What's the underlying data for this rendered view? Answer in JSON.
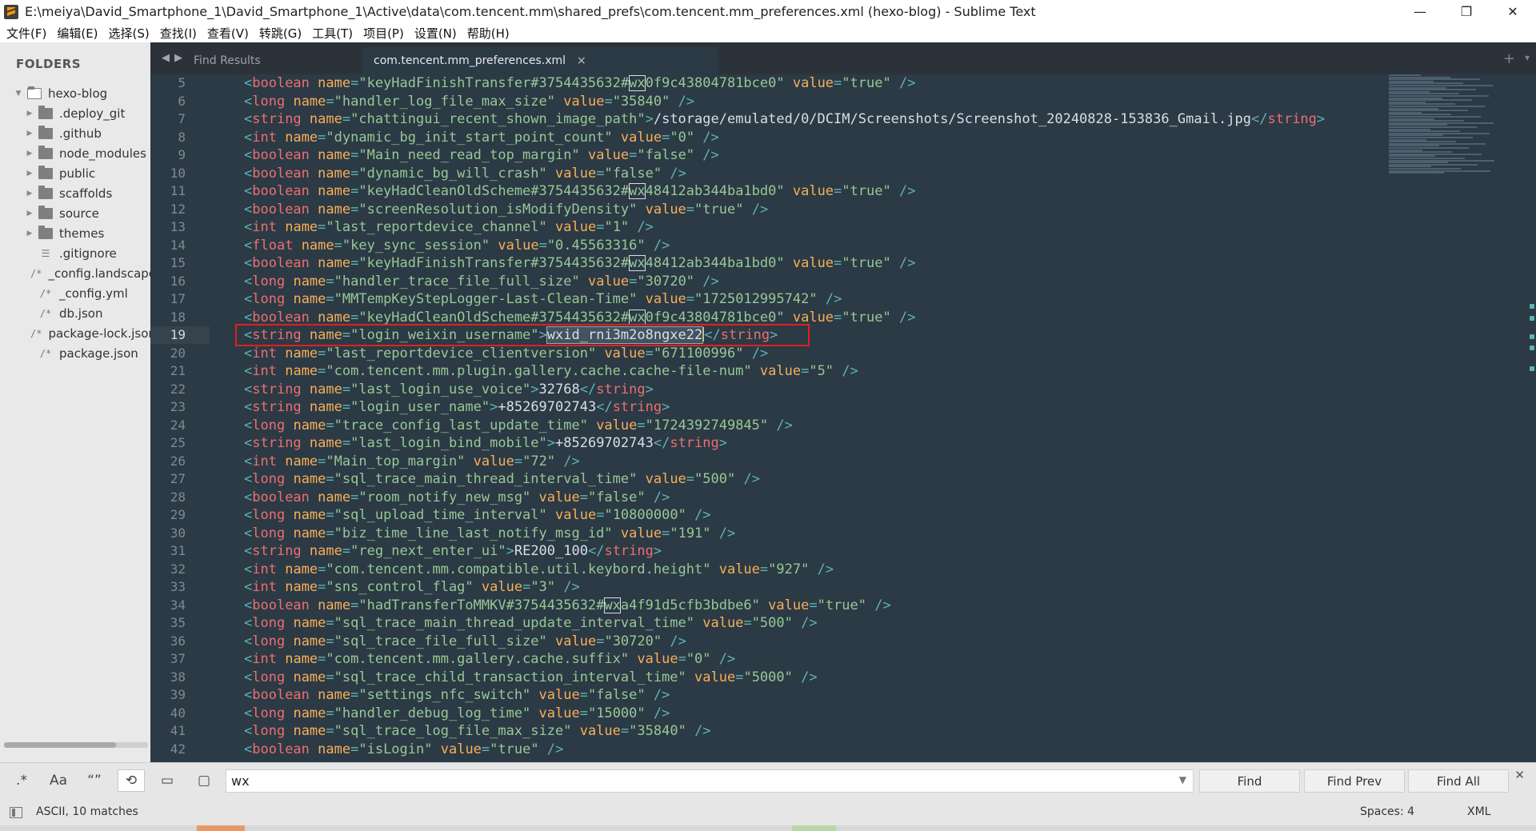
{
  "window": {
    "title": "E:\\meiya\\David_Smartphone_1\\David_Smartphone_1\\Active\\data\\com.tencent.mm\\shared_prefs\\com.tencent.mm_preferences.xml (hexo-blog) - Sublime Text",
    "minimize": "—",
    "maximize": "❐",
    "close": "✕"
  },
  "menu": [
    "文件(F)",
    "编辑(E)",
    "选择(S)",
    "查找(I)",
    "查看(V)",
    "转跳(G)",
    "工具(T)",
    "项目(P)",
    "设置(N)",
    "帮助(H)"
  ],
  "sidebar": {
    "header": "FOLDERS",
    "root": "hexo-blog",
    "items": [
      {
        "label": ".deploy_git",
        "type": "folder"
      },
      {
        "label": ".github",
        "type": "folder"
      },
      {
        "label": "node_modules",
        "type": "folder"
      },
      {
        "label": "public",
        "type": "folder"
      },
      {
        "label": "scaffolds",
        "type": "folder"
      },
      {
        "label": "source",
        "type": "folder"
      },
      {
        "label": "themes",
        "type": "folder"
      },
      {
        "label": ".gitignore",
        "type": "file"
      },
      {
        "label": "_config.landscape",
        "type": "file"
      },
      {
        "label": "_config.yml",
        "type": "file"
      },
      {
        "label": "db.json",
        "type": "file"
      },
      {
        "label": "package-lock.json",
        "type": "file"
      },
      {
        "label": "package.json",
        "type": "file"
      }
    ]
  },
  "tabs": {
    "inactive": "Find Results",
    "active": "com.tencent.mm_preferences.xml",
    "close": "×",
    "plus": "+",
    "dropdown": "▾"
  },
  "editor": {
    "current_line": 19,
    "match_highlight": "wx",
    "lines": [
      {
        "n": 5,
        "tag": "boolean",
        "name": "keyHadFinishTransfer#3754435632#wx0f9c43804781bce0",
        "value": "true"
      },
      {
        "n": 6,
        "tag": "long",
        "name": "handler_log_file_max_size",
        "value": "35840"
      },
      {
        "n": 7,
        "tag": "string",
        "name": "chattingui_recent_shown_image_path",
        "text": "/storage/emulated/0/DCIM/Screenshots/Screenshot_20240828-153836_Gmail.jpg"
      },
      {
        "n": 8,
        "tag": "int",
        "name": "dynamic_bg_init_start_point_count",
        "value": "0"
      },
      {
        "n": 9,
        "tag": "boolean",
        "name": "Main_need_read_top_margin",
        "value": "false"
      },
      {
        "n": 10,
        "tag": "boolean",
        "name": "dynamic_bg_will_crash",
        "value": "false"
      },
      {
        "n": 11,
        "tag": "boolean",
        "name": "keyHadCleanOldScheme#3754435632#wx48412ab344ba1bd0",
        "value": "true"
      },
      {
        "n": 12,
        "tag": "boolean",
        "name": "screenResolution_isModifyDensity",
        "value": "true"
      },
      {
        "n": 13,
        "tag": "int",
        "name": "last_reportdevice_channel",
        "value": "1"
      },
      {
        "n": 14,
        "tag": "float",
        "name": "key_sync_session",
        "value": "0.45563316"
      },
      {
        "n": 15,
        "tag": "boolean",
        "name": "keyHadFinishTransfer#3754435632#wx48412ab344ba1bd0",
        "value": "true"
      },
      {
        "n": 16,
        "tag": "long",
        "name": "handler_trace_file_full_size",
        "value": "30720"
      },
      {
        "n": 17,
        "tag": "long",
        "name": "MMTempKeyStepLogger-Last-Clean-Time",
        "value": "1725012995742"
      },
      {
        "n": 18,
        "tag": "boolean",
        "name": "keyHadCleanOldScheme#3754435632#wx0f9c43804781bce0",
        "value": "true"
      },
      {
        "n": 19,
        "tag": "string",
        "name": "login_weixin_username",
        "text": "wxid_rni3m2o8ngxe22"
      },
      {
        "n": 20,
        "tag": "int",
        "name": "last_reportdevice_clientversion",
        "value": "671100996"
      },
      {
        "n": 21,
        "tag": "int",
        "name": "com.tencent.mm.plugin.gallery.cache.cache-file-num",
        "value": "5"
      },
      {
        "n": 22,
        "tag": "string",
        "name": "last_login_use_voice",
        "text": "32768"
      },
      {
        "n": 23,
        "tag": "string",
        "name": "login_user_name",
        "text": "+85269702743"
      },
      {
        "n": 24,
        "tag": "long",
        "name": "trace_config_last_update_time",
        "value": "1724392749845"
      },
      {
        "n": 25,
        "tag": "string",
        "name": "last_login_bind_mobile",
        "text": "+85269702743"
      },
      {
        "n": 26,
        "tag": "int",
        "name": "Main_top_margin",
        "value": "72"
      },
      {
        "n": 27,
        "tag": "long",
        "name": "sql_trace_main_thread_interval_time",
        "value": "500"
      },
      {
        "n": 28,
        "tag": "boolean",
        "name": "room_notify_new_msg",
        "value": "false"
      },
      {
        "n": 29,
        "tag": "long",
        "name": "sql_upload_time_interval",
        "value": "10800000"
      },
      {
        "n": 30,
        "tag": "long",
        "name": "biz_time_line_last_notify_msg_id",
        "value": "191"
      },
      {
        "n": 31,
        "tag": "string",
        "name": "reg_next_enter_ui",
        "text": "RE200_100"
      },
      {
        "n": 32,
        "tag": "int",
        "name": "com.tencent.mm.compatible.util.keybord.height",
        "value": "927"
      },
      {
        "n": 33,
        "tag": "int",
        "name": "sns_control_flag",
        "value": "3"
      },
      {
        "n": 34,
        "tag": "boolean",
        "name": "hadTransferToMMKV#3754435632#wxa4f91d5cfb3bdbe6",
        "value": "true"
      },
      {
        "n": 35,
        "tag": "long",
        "name": "sql_trace_main_thread_update_interval_time",
        "value": "500"
      },
      {
        "n": 36,
        "tag": "long",
        "name": "sql_trace_file_full_size",
        "value": "30720"
      },
      {
        "n": 37,
        "tag": "int",
        "name": "com.tencent.mm.gallery.cache.suffix",
        "value": "0"
      },
      {
        "n": 38,
        "tag": "long",
        "name": "sql_trace_child_transaction_interval_time",
        "value": "5000"
      },
      {
        "n": 39,
        "tag": "boolean",
        "name": "settings_nfc_switch",
        "value": "false"
      },
      {
        "n": 40,
        "tag": "long",
        "name": "handler_debug_log_time",
        "value": "15000"
      },
      {
        "n": 41,
        "tag": "long",
        "name": "sql_trace_log_file_max_size",
        "value": "35840"
      },
      {
        "n": 42,
        "tag": "boolean",
        "name": "isLogin",
        "value": "true"
      }
    ]
  },
  "find": {
    "options": [
      ".*",
      "Aa",
      "“”",
      "⟲",
      "▭",
      "▢"
    ],
    "query": "wx",
    "find": "Find",
    "find_prev": "Find Prev",
    "find_all": "Find All",
    "close": "✕"
  },
  "status": {
    "left": "ASCII, 10 matches",
    "spaces": "Spaces: 4",
    "syntax": "XML"
  },
  "colors": {
    "editor_bg": "#2b3a45",
    "tag": "#ec6f6f",
    "attr": "#f9ae58",
    "string": "#99c794",
    "annotation_box": "#e02020"
  }
}
